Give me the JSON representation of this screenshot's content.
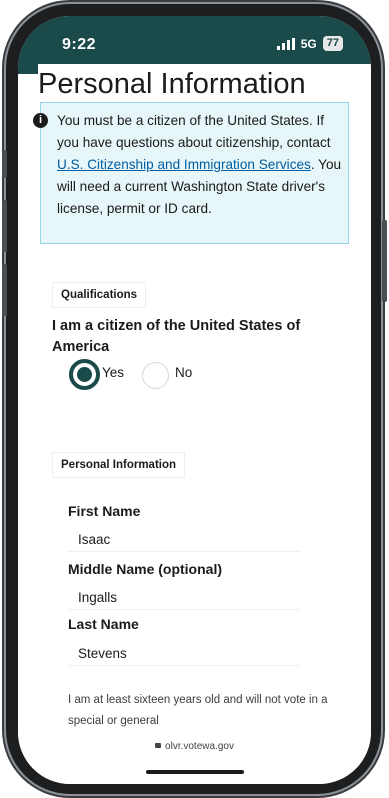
{
  "status_bar": {
    "time": "9:22",
    "network": "5G",
    "battery": "77"
  },
  "page": {
    "title": "Personal Information"
  },
  "alert": {
    "icon": "info-icon",
    "text_before": "You must be a citizen of the United States. If you have questions about citizenship, contact ",
    "link_text": "U.S. Citizenship and Immigration Services",
    "text_after": ". You will need a current Washington State driver's license, permit or ID card."
  },
  "qualifications": {
    "legend": "Qualifications",
    "question": "I am a citizen of the United States of America",
    "options": [
      {
        "label": "Yes",
        "selected": true
      },
      {
        "label": "No",
        "selected": false
      }
    ]
  },
  "personal_info": {
    "legend": "Personal Information",
    "fields": [
      {
        "label": "First Name",
        "value": "Isaac"
      },
      {
        "label": "Middle Name (optional)",
        "value": "Ingalls"
      },
      {
        "label": "Last Name",
        "value": "Stevens"
      }
    ],
    "statement": "I am at least sixteen years old and will not vote in a special or general"
  },
  "browser": {
    "url": "olvr.votewa.gov"
  },
  "colors": {
    "brand_teal": "#1a4a4a",
    "alert_bg": "#e7f6f8",
    "alert_border": "#97d4ea",
    "link": "#005ea2"
  }
}
